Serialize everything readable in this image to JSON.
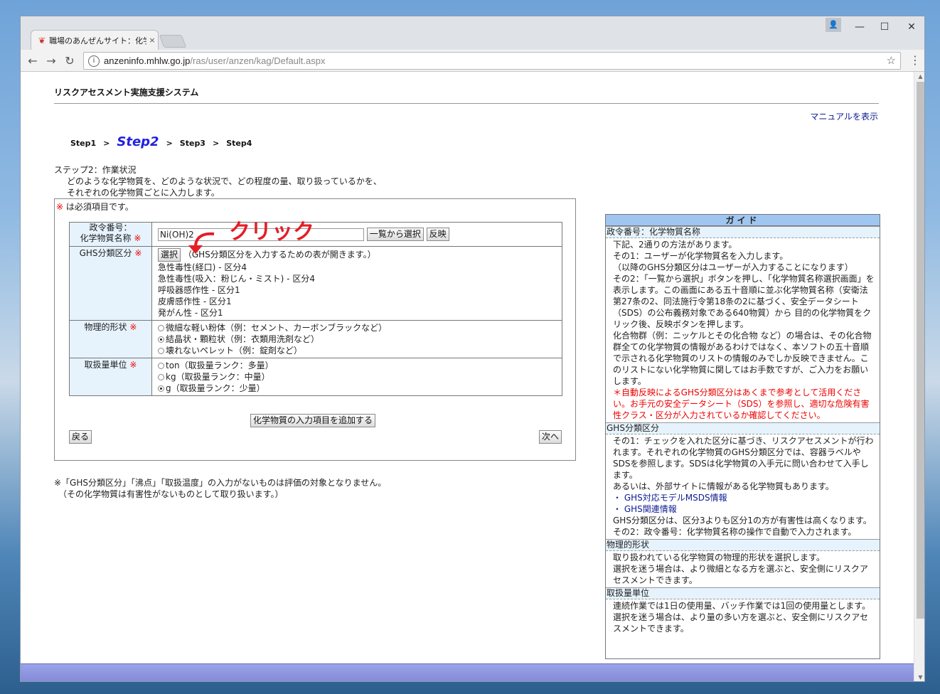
{
  "browser": {
    "tab_title": "職場のあんぜんサイト：化学",
    "url_host": "anzeninfo.mhlw.go.jp",
    "url_path": "/ras/user/anzen/kag/Default.aspx"
  },
  "header": {
    "system_title": "リスクアセスメント実施支援システム",
    "manual_link": "マニュアルを表示"
  },
  "steps": [
    "Step1",
    "Step2",
    "Step3",
    "Step4"
  ],
  "step_separator": ">",
  "description": {
    "title": "ステップ2：作業状況",
    "line1": "どのような化学物質を、どのような状況で、どの程度の量、取り扱っているかを、",
    "line2": "それぞれの化学物質ごとに入力します。"
  },
  "form": {
    "required_mark": "※",
    "required_note": "は必須項目です。",
    "chem_label_1": "政令番号：",
    "chem_label_2": "化学物質名称",
    "chem_value": "Ni(OH)2",
    "select_from_list": "一覧から選択",
    "reflect": "反映",
    "ghs_label": "GHS分類区分",
    "select_button": "選択",
    "select_hint": "（GHS分類区分を入力するための表が開きます。）",
    "ghs_items": [
      "急性毒性(経口) - 区分4",
      "急性毒性(吸入：粉じん・ミスト) - 区分4",
      "呼吸器感作性 - 区分1",
      "皮膚感作性 - 区分1",
      "発がん性 - 区分1"
    ],
    "physical_label": "物理的形状",
    "physical_options": [
      {
        "label": "微細な軽い粉体（例：セメント、カーボンブラックなど）",
        "checked": false
      },
      {
        "label": "結晶状・顆粒状（例：衣類用洗剤など）",
        "checked": true
      },
      {
        "label": "壊れないペレット（例：錠剤など）",
        "checked": false
      }
    ],
    "quantity_label": "取扱量単位",
    "quantity_options": [
      {
        "label": "ton（取扱量ランク：多量）",
        "checked": false
      },
      {
        "label": "kg（取扱量ランク：中量）",
        "checked": false
      },
      {
        "label": "g（取扱量ランク：少量）",
        "checked": true
      }
    ],
    "add_button": "化学物質の入力項目を追加する",
    "back_button": "戻る",
    "next_button": "次へ"
  },
  "annotation": "クリック",
  "notes": {
    "line1": "※「GHS分類区分」「沸点」「取扱温度」の入力がないものは評価の対象となりません。",
    "line2": "（その化学物質は有害性がないものとして取り扱います。）"
  },
  "guide": {
    "title": "ガイド",
    "sections": [
      {
        "heading": "政令番号：化学物質名称",
        "lines": [
          "下記、2通りの方法があります。",
          "その1：ユーザーが化学物質名を入力します。",
          "（以降のGHS分類区分はユーザーが入力することになります）",
          "その2：「一覧から選択」ボタンを押し、「化学物質名称選択画面」を表示します。この画面にある五十音順に並ぶ化学物質名称（安衛法第27条の2、同法施行令第18条の2に基づく、安全データシート（SDS）の公布義務対象である640物質）から 目的の化学物質をクリック後、反映ボタンを押します。",
          "化合物群（例：ニッケルとその化合物 など）の場合は、その化合物群全ての化学物質の情報があるわけではなく、本ソフトの五十音順で示される化学物質のリストの情報のみでしか反映できません。このリストにない化学物質に関してはお手数ですが、ご入力をお願いします。"
        ],
        "red_line": "＊自動反映によるGHS分類区分はあくまで参考として活用ください。お手元の安全データシート（SDS）を参照し、適切な危険有害性クラス・区分が入力されているか確認してください。"
      },
      {
        "heading": "GHS分類区分",
        "lines": [
          "その1：チェックを入れた区分に基づき、リスクアセスメントが行われます。それぞれの化学物質のGHS分類区分では、容器ラベルやSDSを参照します。SDSは化学物質の入手元に問い合わせて入手します。",
          "あるいは、外部サイトに情報がある化学物質もあります。"
        ],
        "links": [
          "・ GHS対応モデルMSDS情報",
          "・ GHS関連情報"
        ],
        "lines_after": [
          "GHS分類区分は、区分3よりも区分1の方が有害性は高くなります。",
          "その2：政令番号：化学物質名称の操作で自動で入力されます。"
        ]
      },
      {
        "heading": "物理的形状",
        "lines": [
          "取り扱われている化学物質の物理的形状を選択します。",
          "選択を迷う場合は、より微細となる方を選ぶと、安全側にリスクアセスメントできます。"
        ]
      },
      {
        "heading": "取扱量単位",
        "lines": [
          "連続作業では1日の使用量、バッチ作業では1回の使用量とします。",
          "選択を迷う場合は、より量の多い方を選ぶと、安全側にリスクアセスメントできます。"
        ]
      }
    ]
  }
}
